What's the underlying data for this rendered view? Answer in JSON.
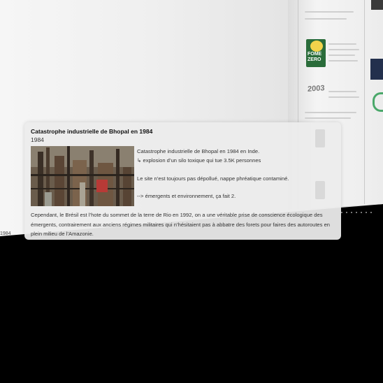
{
  "background": {
    "year_text": "2003",
    "logo_text": "FOME ZERO",
    "floor_label": "1984"
  },
  "card": {
    "title": "Catastrophe industrielle de Bhopal en 1984",
    "year": "1984",
    "image_alt": "Usine de Bhopal",
    "p1": "Catastrophe industrielle de Bhopal en 1984 en Inde.",
    "p2": "↳ explosion d’un silo toxique qui tue 3.5K personnes",
    "p3": "Le site n’est toujours pas dépollué, nappe phréatique contaminé.",
    "p4": "--> émergents et environnement, ça fait 2.",
    "p5": "Cependant, le Brésil est l’hote du sommet de la terre de Rio en 1992, on a une véritable prise de conscience écologique des émergents, contrairement aux anciens régimes militaires qui n’hésitaient pas à abbatre des forets pour faires des autoroutes en plein milieu de l’Amazonie."
  },
  "colors": {
    "background": "#000000",
    "wall": "#efefef",
    "card": "#ececec",
    "logo_green": "#2a6c3a",
    "logo_yellow": "#f2d34b"
  }
}
